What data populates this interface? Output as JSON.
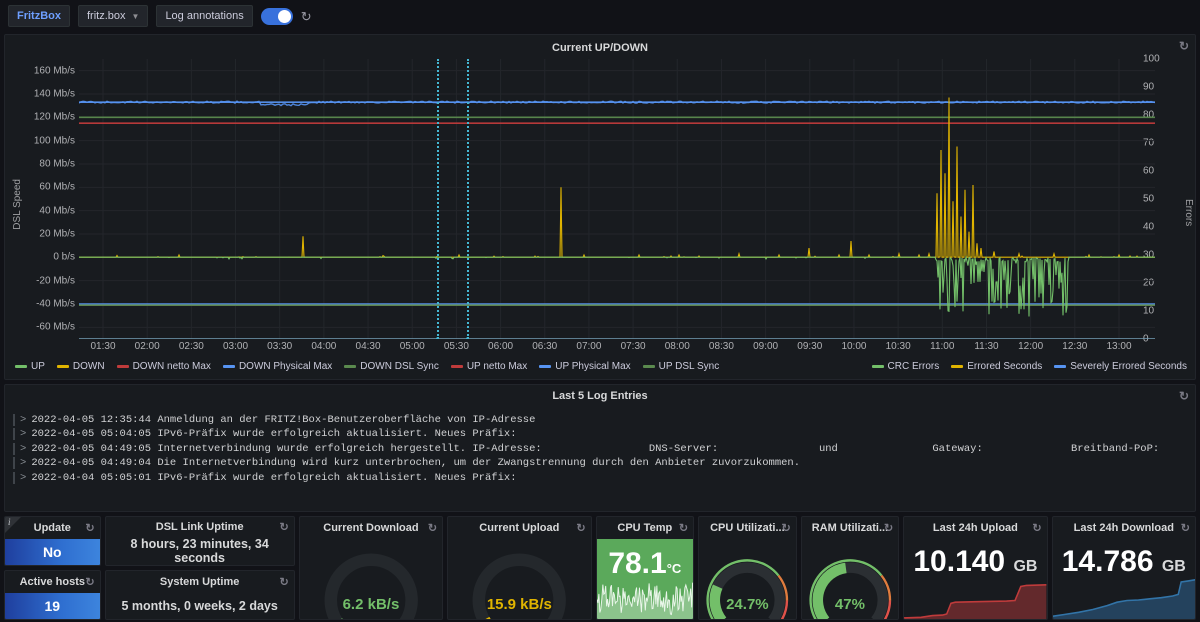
{
  "toolbar": {
    "brand_label": "FritzBox",
    "host_label": "fritz.box",
    "host_caret": "chevron-down-icon",
    "log_annotations_label": "Log annotations",
    "toggle_on": true,
    "refresh_glyph": "↻"
  },
  "graph_panel": {
    "title": "Current UP/DOWN",
    "refresh_glyph": "↻"
  },
  "chart_data": {
    "type": "line",
    "title": "Current UP/DOWN",
    "xlabel": "",
    "ylabel": "DSL Speed",
    "y2label": "Errors",
    "ylim": [
      -70,
      170
    ],
    "y2lim": [
      0,
      100
    ],
    "grid": true,
    "legend_position": "bottom",
    "y_ticks": [
      "160 Mb/s",
      "140 Mb/s",
      "120 Mb/s",
      "100 Mb/s",
      "80 Mb/s",
      "60 Mb/s",
      "40 Mb/s",
      "20 Mb/s",
      "0 b/s",
      "-20 Mb/s",
      "-40 Mb/s",
      "-60 Mb/s"
    ],
    "y_tick_values": [
      160,
      140,
      120,
      100,
      80,
      60,
      40,
      20,
      0,
      -20,
      -40,
      -60
    ],
    "y2_ticks": [
      "100",
      "90",
      "80",
      "70",
      "60",
      "50",
      "40",
      "30",
      "20",
      "10",
      "0"
    ],
    "y2_tick_values": [
      100,
      90,
      80,
      70,
      60,
      50,
      40,
      30,
      20,
      10,
      0
    ],
    "x_ticks": [
      "01:30",
      "02:00",
      "02:30",
      "03:00",
      "03:30",
      "04:00",
      "04:30",
      "05:00",
      "05:30",
      "06:00",
      "06:30",
      "07:00",
      "07:30",
      "08:00",
      "08:30",
      "09:00",
      "09:30",
      "10:00",
      "10:30",
      "11:00",
      "11:30",
      "12:00",
      "12:30",
      "13:00"
    ],
    "annotations": [
      {
        "x_label": "04:52",
        "color": "#44b7d3",
        "style": "dotted"
      },
      {
        "x_label": "05:02",
        "color": "#44b7d3",
        "style": "dotted"
      }
    ],
    "series": [
      {
        "name": "UP",
        "color": "#73bf69",
        "axis": "left",
        "baseline": 0,
        "note": "near 0 with downward spikes to about -50 Mb/s between 10:45 and 11:25"
      },
      {
        "name": "DOWN",
        "color": "#e0b400",
        "axis": "left",
        "baseline": 0,
        "note": "near 0 with spikes; 20 Mb/s spike at ~03:45, 60 Mb/s spike at ~06:45, peak ~137 Mb/s near 10:50"
      },
      {
        "name": "DOWN netto Max",
        "color": "#bf3b3b",
        "axis": "left",
        "value": 115
      },
      {
        "name": "DOWN Physical Max",
        "color": "#5794f2",
        "axis": "left",
        "value": 133
      },
      {
        "name": "DOWN DSL Sync",
        "color": "#5a8a4e",
        "axis": "left",
        "value": 120
      },
      {
        "name": "UP netto Max",
        "color": "#bf3b3b",
        "axis": "left",
        "value": -41
      },
      {
        "name": "UP Physical Max",
        "color": "#5794f2",
        "axis": "left",
        "value": -40
      },
      {
        "name": "UP DSL Sync",
        "color": "#5a8a4e",
        "axis": "left",
        "value": -41
      },
      {
        "name": "CRC Errors",
        "color": "#73bf69",
        "axis": "right",
        "value": 0
      },
      {
        "name": "Errored Seconds",
        "color": "#e0b400",
        "axis": "right",
        "value": 0
      },
      {
        "name": "Severely Errored Seconds",
        "color": "#5794f2",
        "axis": "right",
        "value": 0
      }
    ],
    "legend_left": [
      {
        "label": "UP",
        "color": "#73bf69"
      },
      {
        "label": "DOWN",
        "color": "#e0b400"
      },
      {
        "label": "DOWN netto Max",
        "color": "#bf3b3b"
      },
      {
        "label": "DOWN Physical Max",
        "color": "#5794f2"
      },
      {
        "label": "DOWN DSL Sync",
        "color": "#5a8a4e"
      },
      {
        "label": "UP netto Max",
        "color": "#bf3b3b"
      },
      {
        "label": "UP Physical Max",
        "color": "#5794f2"
      },
      {
        "label": "UP DSL Sync",
        "color": "#5a8a4e"
      }
    ],
    "legend_right": [
      {
        "label": "CRC Errors",
        "color": "#73bf69"
      },
      {
        "label": "Errored Seconds",
        "color": "#e0b400"
      },
      {
        "label": "Severely Errored Seconds",
        "color": "#5794f2"
      }
    ]
  },
  "logs_panel": {
    "title": "Last 5 Log Entries",
    "refresh_glyph": "↻",
    "caret": ">",
    "entries": [
      "2022-04-05 12:35:44 Anmeldung an der FRITZ!Box-Benutzeroberfläche von IP-Adresse",
      "2022-04-05 05:04:05 IPv6-Präfix wurde erfolgreich aktualisiert. Neues Präfix:",
      "2022-04-05 04:49:05 Internetverbindung wurde erfolgreich hergestellt. IP-Adresse:                 DNS-Server:                und               Gateway:              Breitband-PoP:",
      "2022-04-05 04:49:04 Die Internetverbindung wird kurz unterbrochen, um der Zwangstrennung durch den Anbieter zuvorzukommen.",
      "2022-04-04 05:05:01 IPv6-Präfix wurde erfolgreich aktualisiert. Neues Präfix:"
    ]
  },
  "stats": {
    "update": {
      "title": "Update",
      "value": "No",
      "refresh_glyph": "↻",
      "has_info_corner": true,
      "info_glyph": "i"
    },
    "active_hosts": {
      "title": "Active hosts",
      "value": "19",
      "refresh_glyph": "↻"
    },
    "dsl_link_uptime": {
      "title": "DSL Link Uptime",
      "value": "8 hours, 23 minutes, 34 seconds",
      "refresh_glyph": "↻"
    },
    "system_uptime": {
      "title": "System Uptime",
      "value": "5 months, 0 weeks, 2 days",
      "refresh_glyph": "↻"
    },
    "current_download": {
      "title": "Current Download",
      "value": "6.2 kB/s",
      "color": "#73bf69",
      "gauge_percent": 3,
      "refresh_glyph": "↻"
    },
    "current_upload": {
      "title": "Current Upload",
      "value": "15.9 kB/s",
      "color": "#e0b400",
      "gauge_percent": 4,
      "refresh_glyph": "↻"
    },
    "cpu_temp": {
      "title": "CPU Temp",
      "value": "78.1",
      "unit": "°C",
      "bg_color": "#5ba95b",
      "refresh_glyph": "↻"
    },
    "cpu_utilization": {
      "title": "CPU Utilizati...",
      "value": "24.7%",
      "color": "#73bf69",
      "gauge_percent": 24.7,
      "refresh_glyph": "↻"
    },
    "ram_utilization": {
      "title": "RAM Utilizati...",
      "value": "47%",
      "color": "#73bf69",
      "gauge_percent": 47,
      "refresh_glyph": "↻"
    },
    "last_24h_upload": {
      "title": "Last 24h Upload",
      "value": "10.140",
      "unit": "GB",
      "color": "#bf3b3b",
      "refresh_glyph": "↻"
    },
    "last_24h_download": {
      "title": "Last 24h Download",
      "value": "14.786",
      "unit": "GB",
      "color": "#3274a8",
      "refresh_glyph": "↻"
    }
  }
}
